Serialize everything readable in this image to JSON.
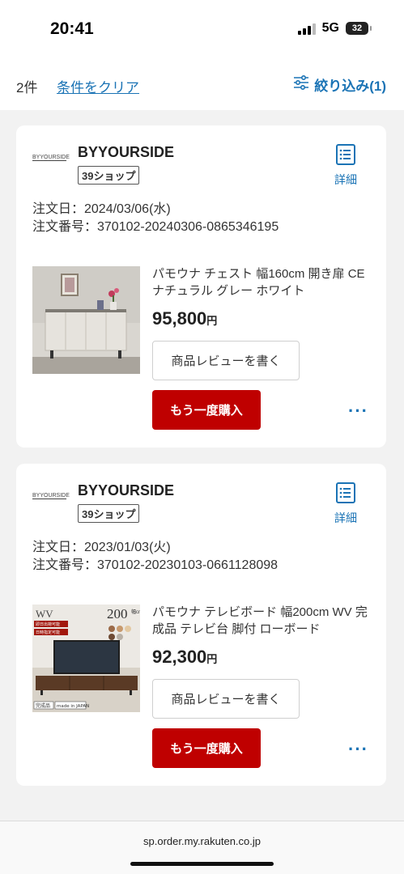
{
  "status_bar": {
    "time": "20:41",
    "network": "5G",
    "battery": "32"
  },
  "filter_bar": {
    "count": "2件",
    "clear_label": "条件をクリア",
    "filter_label": "絞り込み(1)"
  },
  "orders": [
    {
      "shop_logo": "BYYOURSIDE",
      "shop_name": "BYYOURSIDE",
      "shop_badge": "39ショップ",
      "detail_label": "詳細",
      "order_date": "注文日：2024/03/06(水)",
      "order_number": "注文番号：370102-20240306-0865346195",
      "product_name": "パモウナ チェスト 幅160cm 開き扉 CE ナチュラル グレー ホワイト",
      "price": "95,800",
      "price_unit": "円",
      "review_label": "商品レビューを書く",
      "rebuy_label": "もう一度購入",
      "more_label": "···"
    },
    {
      "shop_logo": "BYYOURSIDE",
      "shop_name": "BYYOURSIDE",
      "shop_badge": "39ショップ",
      "detail_label": "詳細",
      "order_date": "注文日：2023/01/03(火)",
      "order_number": "注文番号：370102-20230103-0661128098",
      "product_name": "パモウナ テレビボード 幅200cm WV 完成品 テレビ台 脚付 ローボード",
      "price": "92,300",
      "price_unit": "円",
      "review_label": "商品レビューを書く",
      "rebuy_label": "もう一度購入",
      "more_label": "···",
      "image_text": {
        "brand": "WV",
        "width": "200",
        "width_unit": "幅cm",
        "tag_top": "即日出荷可能",
        "tag_bottom": "日時指定可能",
        "footer_left": "完成品",
        "footer_right": "made in JAPAN"
      }
    }
  ],
  "browser": {
    "url": "sp.order.my.rakuten.co.jp"
  }
}
